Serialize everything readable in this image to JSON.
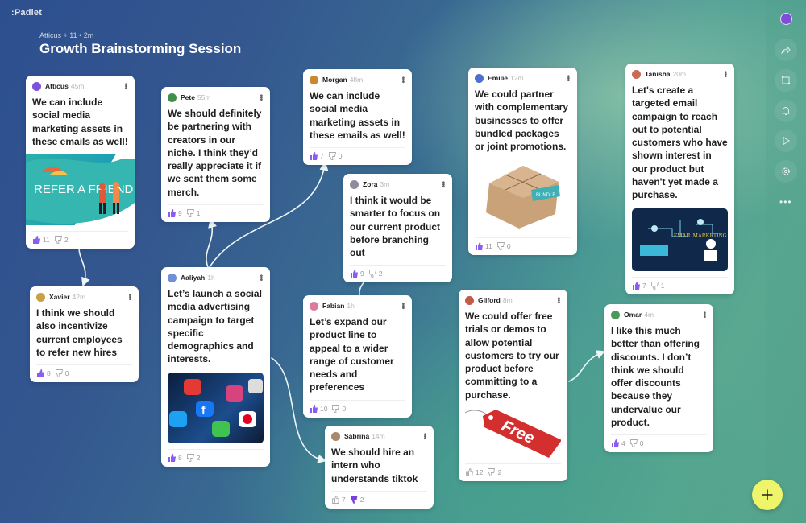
{
  "app": {
    "logo": ":Padlet"
  },
  "header": {
    "subtitle": "Atticus + 11 • 2m",
    "title": "Growth Brainstorming Session"
  },
  "colors": {
    "like_active": "#8a5cf0",
    "dislike_active": "#7a3fe0",
    "fab": "#eef56b",
    "connector": "#eef6f6"
  },
  "posts": [
    {
      "id": "atticus",
      "author": "Atticus",
      "time": "45m",
      "text": "We can include social media marketing assets in these emails as well!",
      "attachment": {
        "type": "image",
        "label": "REFER A FRIEND"
      },
      "likes": "11",
      "dislikes": "2",
      "liked": true,
      "disliked": false
    },
    {
      "id": "pete",
      "author": "Pete",
      "time": "55m",
      "text": "We should definitely be partnering with creators in our niche. I think they’d really appreciate it if we sent them some merch.",
      "likes": "9",
      "dislikes": "1",
      "liked": true,
      "disliked": false
    },
    {
      "id": "morgan",
      "author": "Morgan",
      "time": "48m",
      "text": "We can include social media marketing assets in these emails as well!",
      "likes": "7",
      "dislikes": "0",
      "liked": true,
      "disliked": false
    },
    {
      "id": "emilie",
      "author": "Emilie",
      "time": "12m",
      "text": "We could partner with complementary businesses to offer bundled packages or joint promotions.",
      "attachment": {
        "type": "image",
        "label": "BUNDLE"
      },
      "likes": "11",
      "dislikes": "0",
      "liked": true,
      "disliked": false
    },
    {
      "id": "tanisha",
      "author": "Tanisha",
      "time": "20m",
      "text": "Let's create a targeted email campaign to reach out to potential customers who have shown interest in our product but haven't yet made a purchase.",
      "attachment": {
        "type": "image",
        "label": "EMAIL MARKETING"
      },
      "likes": "7",
      "dislikes": "1",
      "liked": true,
      "disliked": false
    },
    {
      "id": "zora",
      "author": "Zora",
      "time": "3m",
      "text": "I think it would be smarter to focus on our current product before branching out",
      "likes": "9",
      "dislikes": "2",
      "liked": true,
      "disliked": false
    },
    {
      "id": "xavier",
      "author": "Xavier",
      "time": "42m",
      "text": "I think we should also incentivize current employees to refer new hires",
      "likes": "8",
      "dislikes": "0",
      "liked": true,
      "disliked": false
    },
    {
      "id": "aaliyah",
      "author": "Aaliyah",
      "time": "1h",
      "text": "Let’s launch a social media advertising campaign to target specific demographics and interests.",
      "attachment": {
        "type": "image",
        "label": "social media app icons"
      },
      "likes": "8",
      "dislikes": "2",
      "liked": true,
      "disliked": false
    },
    {
      "id": "fabian",
      "author": "Fabian",
      "time": "1h",
      "text": "Let’s expand our product line to appeal to a wider range of customer needs and preferences",
      "likes": "10",
      "dislikes": "0",
      "liked": true,
      "disliked": false
    },
    {
      "id": "sabrina",
      "author": "Sabrina",
      "time": "14m",
      "text": "We should hire an intern who understands tiktok",
      "likes": "7",
      "dislikes": "2",
      "liked": false,
      "disliked": true
    },
    {
      "id": "gilford",
      "author": "Gilford",
      "time": "8m",
      "text": "We could offer free trials or demos to allow potential customers to try our product before committing to a purchase.",
      "attachment": {
        "type": "image",
        "label": "Free"
      },
      "likes": "12",
      "dislikes": "2",
      "liked": false,
      "disliked": false
    },
    {
      "id": "omar",
      "author": "Omar",
      "time": "4m",
      "text": "I like this much better than offering discounts. I don’t think we should offer discounts because they undervalue our product.",
      "likes": "4",
      "dislikes": "0",
      "liked": true,
      "disliked": false
    }
  ],
  "connections": [
    {
      "from": "Atticus",
      "to": "Xavier"
    },
    {
      "from": "Aaliyah",
      "to": "Pete"
    },
    {
      "from": "Aaliyah",
      "to": "Morgan"
    },
    {
      "from": "Aaliyah",
      "to": "Sabrina"
    },
    {
      "from": "Fabian",
      "to": "Zora"
    },
    {
      "from": "Gilford",
      "to": "Omar"
    }
  ],
  "rail": {
    "items": [
      {
        "icon": "share-icon",
        "label": "Share"
      },
      {
        "icon": "remake-icon",
        "label": "Remake"
      },
      {
        "icon": "bell-icon",
        "label": "Notifications"
      },
      {
        "icon": "play-icon",
        "label": "Slideshow"
      },
      {
        "icon": "gear-icon",
        "label": "Settings"
      }
    ],
    "more": "•••"
  },
  "fab": {
    "icon": "plus-icon",
    "label": "Add post"
  }
}
